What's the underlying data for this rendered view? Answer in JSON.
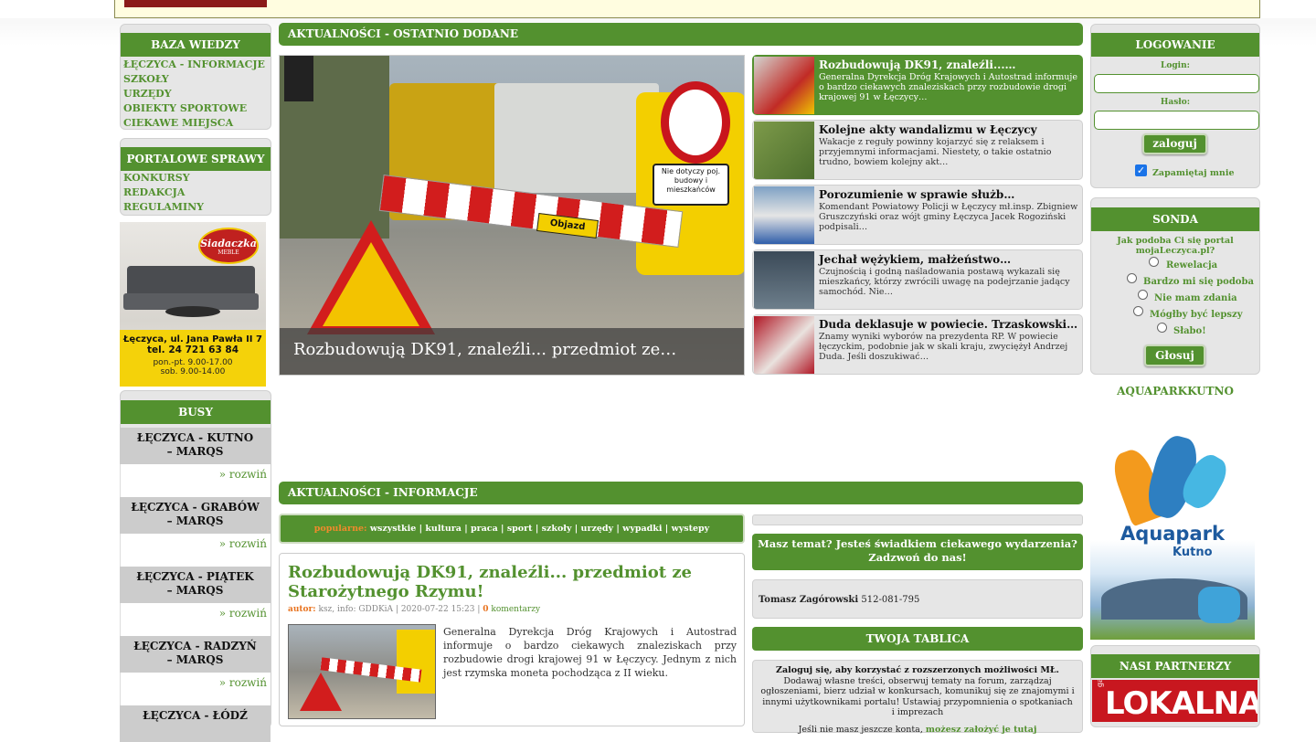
{
  "top_banner": {
    "text": ""
  },
  "left": {
    "baza": {
      "title": "BAZA WIEDZY",
      "items": [
        "ŁĘCZYCA - INFORMACJE",
        "SZKOŁY",
        "URZĘDY",
        "OBIEKTY SPORTOWE",
        "CIEKAWE MIEJSCA"
      ]
    },
    "portal": {
      "title": "PORTALOWE SPRAWY",
      "items": [
        "KONKURSY",
        "REDAKCJA",
        "REGULAMINY"
      ]
    },
    "ad": {
      "brand": "Siadaczka",
      "brand_sub": "MEBLE",
      "address": "Łęczyca, ul. Jana Pawła II 7",
      "phone": "tel. 24 721 63 84",
      "hours1": "pon.-pt. 9.00-17.00",
      "hours2": "sob. 9.00-14.00"
    },
    "busy": {
      "title": "BUSY",
      "expand": "» rozwiń",
      "items": [
        {
          "l1": "ŁĘCZYCA - KUTNO",
          "l2": "– MARQS"
        },
        {
          "l1": "ŁĘCZYCA - GRABÓW",
          "l2": "– MARQS"
        },
        {
          "l1": "ŁĘCZYCA - PIĄTEK",
          "l2": "– MARQS"
        },
        {
          "l1": "ŁĘCZYCA - RADZYŃ",
          "l2": "– MARQS"
        },
        {
          "l1": "ŁĘCZYCA - ŁÓDŹ",
          "l2": ""
        }
      ]
    }
  },
  "center": {
    "latest_title": "AKTUALNOŚCI - OSTATNIO DODANE",
    "hero_caption": "Rozbudowują DK91, znaleźli... przedmiot ze…",
    "hero_sign": "Objazd",
    "hero_sign2": "Nie dotyczy poj. budowy i mieszkańców",
    "news": [
      {
        "title": "Rozbudowują DK91, znaleźli...…",
        "desc": "Generalna Dyrekcja Dróg Krajowych i Autostrad informuje o bardzo ciekawych znaleziskach przy rozbudowie drogi krajowej 91 w Łęczycy…"
      },
      {
        "title": "Kolejne akty wandalizmu w Łęczycy",
        "desc": "Wakacje z reguły powinny kojarzyć się z relaksem i przyjemnymi informacjami. Niestety, o takie ostatnio trudno, bowiem kolejny akt…"
      },
      {
        "title": "Porozumienie w sprawie służb…",
        "desc": "Komendant Powiatowy Policji w Łęczycy mł.insp. Zbigniew Gruszczyński oraz wójt gminy Łęczyca Jacek Rogoziński podpisali…"
      },
      {
        "title": "Jechał wężykiem, małżeństwo…",
        "desc": "Czujnością i godną naśladowania postawą wykazali się mieszkańcy, którzy zwrócili uwagę na podejrzanie jadący samochód. Nie…"
      },
      {
        "title": "Duda deklasuje w powiecie. Trzaskowski…",
        "desc": "Znamy wyniki wyborów na prezydenta RP. W powiecie łęczyckim, podobnie jak w skali kraju, zwyciężył Andrzej Duda. Jeśli doszukiwać…"
      }
    ],
    "info_title": "AKTUALNOŚCI - INFORMACJE",
    "tags_label": "popularne:",
    "tags": [
      "wszystkie",
      "kultura",
      "praca",
      "sport",
      "szkoły",
      "urzędy",
      "wypadki",
      "wystepy"
    ],
    "article": {
      "title": "Rozbudowują DK91, znaleźli... przedmiot ze Starożytnego Rzymu!",
      "author_label": "autor:",
      "meta": "ksz, info: GDDKiA | 2020-07-22 15:23 |",
      "comments_count": "0",
      "comments_label": "komentarzy",
      "body": "Generalna Dyrekcja Dróg Krajowych i Autostrad informuje o bardzo ciekawych znaleziskach przy rozbudowie drogi krajowej 91 w Łęczycy. Jednym z nich jest rzymska moneta pochodząca z II wieku."
    },
    "contact": {
      "title": "Masz temat? Jesteś świadkiem ciekawego wydarzenia? Zadzwoń do nas!",
      "name": "Tomasz Zagórowski",
      "phone": "512-081-795"
    },
    "tablica": {
      "title": "TWOJA TABLICA",
      "bold": "Zaloguj się, aby korzystać z rozszerzonych możliwości MŁ.",
      "text": "Dodawaj własne treści, obserwuj tematy na forum, zarządzaj ogłoszeniami, bierz udział w konkursach, komunikuj się ze znajomymi i innymi użytkownikami portalu! Ustawiaj przypomnienia o spotkaniach i imprezach",
      "more": "Jeśli nie masz jeszcze konta,",
      "link": "możesz założyć je tutaj"
    }
  },
  "right": {
    "login": {
      "title": "LOGOWANIE",
      "login_label": "Login:",
      "password_label": "Hasło:",
      "button": "zaloguj",
      "remember": "Zapamiętaj mnie"
    },
    "sonda": {
      "title": "SONDA",
      "question": "Jak podoba Ci się portal mojaLeczyca.pl?",
      "options": [
        "Rewelacja",
        "Bardzo mi się podoba",
        "Nie mam zdania",
        "Mógłby być lepszy",
        "Słabo!"
      ],
      "button": "Głosuj"
    },
    "aqua": {
      "title": "AQUAPARKKUTNO",
      "logo1": "Aquapark",
      "logo2": "Kutno"
    },
    "partners": {
      "title": "NASI PARTNERZY",
      "logo": "LOKALNA",
      "logo_small": "gazeta"
    }
  },
  "colors": {
    "green": "#53912f",
    "grey_box": "#e6e6e6",
    "orange": "#e8731f"
  }
}
